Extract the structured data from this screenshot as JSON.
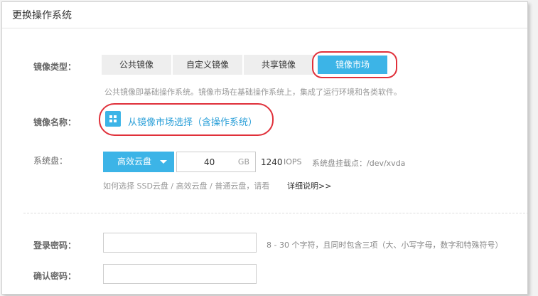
{
  "header": {
    "title": "更换操作系统"
  },
  "image_type": {
    "label": "镜像类型：",
    "tabs": [
      {
        "label": "公共镜像",
        "active": false
      },
      {
        "label": "自定义镜像",
        "active": false
      },
      {
        "label": "共享镜像",
        "active": false
      },
      {
        "label": "镜像市场",
        "active": true
      }
    ],
    "description": "公共镜像即基础操作系统。镜像市场在基础操作系统上，集成了运行环境和各类软件。"
  },
  "image_name": {
    "label": "镜像名称：",
    "select_link": "从镜像市场选择（含操作系统）",
    "icon": "grid-icon"
  },
  "system_disk": {
    "label": "系统盘：",
    "type_value": "高效云盘",
    "size_value": "40",
    "size_unit": "GB",
    "iops_value": "1240",
    "iops_unit": "IOPS",
    "mount_text": "系统盘挂载点：/dev/xvda",
    "help_text": "如何选择 SSD云盘 / 高效云盘 / 普通云盘，请看",
    "help_link": "详细说明>>"
  },
  "login_password": {
    "label": "登录密码：",
    "value": "",
    "hint": "8 - 30 个字符，且同时包含三项（大、小写字母，数字和特殊符号）"
  },
  "confirm_password": {
    "label": "确认密码：",
    "value": ""
  },
  "colors": {
    "accent": "#3cb4e7",
    "highlight": "#e0303a",
    "link": "#2a9fd8"
  }
}
